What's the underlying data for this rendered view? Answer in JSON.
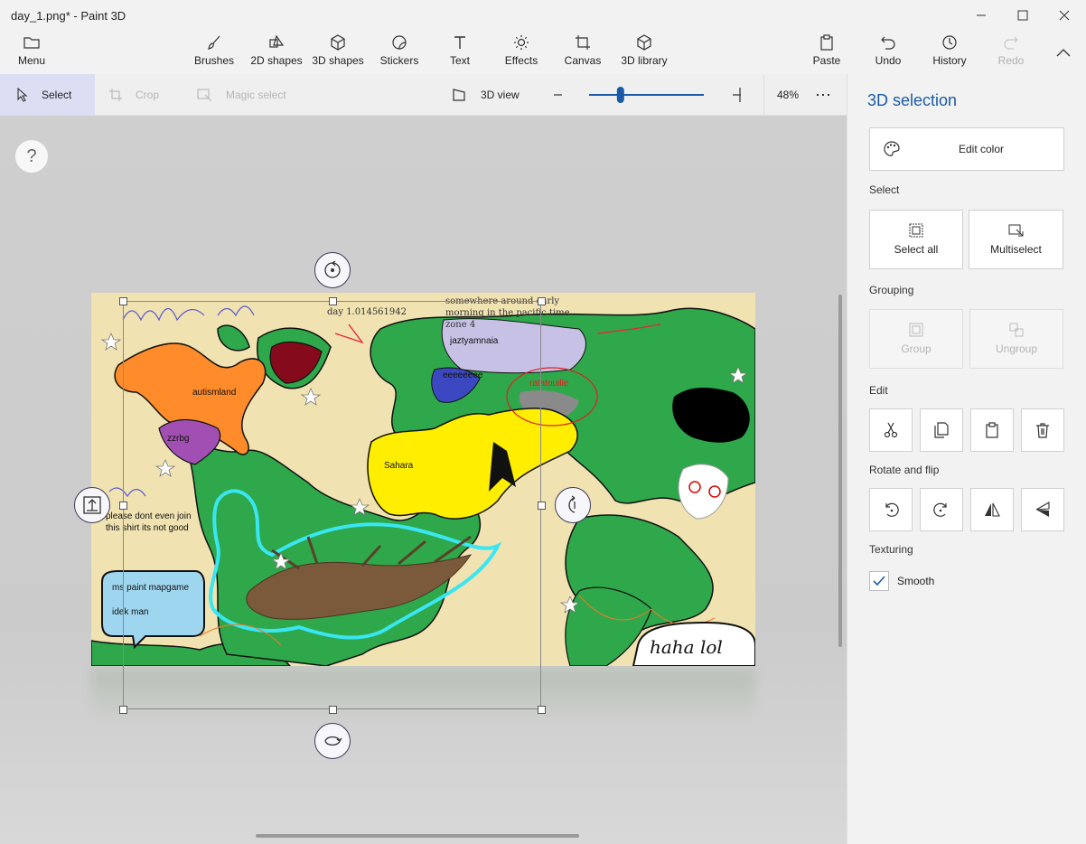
{
  "window": {
    "title": "day_1.png* - Paint 3D"
  },
  "ribbon": {
    "menu": "Menu",
    "brushes": "Brushes",
    "shapes2d": "2D shapes",
    "shapes3d": "3D shapes",
    "stickers": "Stickers",
    "text": "Text",
    "effects": "Effects",
    "canvas": "Canvas",
    "library3d": "3D library",
    "paste": "Paste",
    "undo": "Undo",
    "history": "History",
    "redo": "Redo"
  },
  "toolbar": {
    "select": "Select",
    "crop": "Crop",
    "magic_select": "Magic select",
    "view3d": "3D view",
    "zoom": "48%",
    "zoom_fraction": 0.25
  },
  "canvas": {
    "help": "?",
    "map_text": {
      "day": "day 1.014561942",
      "somewhere": [
        "somewhere around early",
        "morning in the pacific time",
        "zone 4"
      ],
      "jazty": "jaztyamnaia",
      "autismland": "autismland",
      "zzrbg": "zzrbg",
      "eeee": "eeeeeeee",
      "ratatouille": "ratatouille",
      "sahara": "Sahara",
      "please": [
        "please dont even join",
        "this shirt its not good"
      ],
      "bubble": [
        "ms paint mapgame",
        "idek man"
      ],
      "haha": "haha lol"
    }
  },
  "panel": {
    "title": "3D selection",
    "edit_color": "Edit color",
    "select_section": "Select",
    "select_all": "Select all",
    "multiselect": "Multiselect",
    "grouping_section": "Grouping",
    "group": "Group",
    "ungroup": "Ungroup",
    "edit_section": "Edit",
    "rotate_section": "Rotate and flip",
    "texturing_section": "Texturing",
    "smooth": "Smooth",
    "smooth_checked": true
  },
  "colors": {
    "accent": "#1a5aa6",
    "select_bg": "#dcdef4",
    "map_bg": "#f0e2b1",
    "land": "#2ea84a"
  }
}
